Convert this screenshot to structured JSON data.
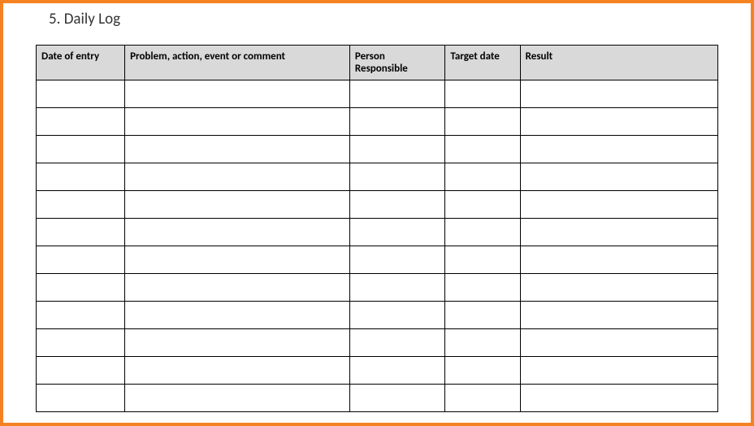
{
  "title": "5. Daily Log",
  "columns": [
    "Date of entry",
    "Problem, action, event or comment",
    "Person Responsible",
    "Target date",
    "Result"
  ],
  "rows": [
    [
      "",
      "",
      "",
      "",
      ""
    ],
    [
      "",
      "",
      "",
      "",
      ""
    ],
    [
      "",
      "",
      "",
      "",
      ""
    ],
    [
      "",
      "",
      "",
      "",
      ""
    ],
    [
      "",
      "",
      "",
      "",
      ""
    ],
    [
      "",
      "",
      "",
      "",
      ""
    ],
    [
      "",
      "",
      "",
      "",
      ""
    ],
    [
      "",
      "",
      "",
      "",
      ""
    ],
    [
      "",
      "",
      "",
      "",
      ""
    ],
    [
      "",
      "",
      "",
      "",
      ""
    ],
    [
      "",
      "",
      "",
      "",
      ""
    ],
    [
      "",
      "",
      "",
      "",
      ""
    ]
  ]
}
